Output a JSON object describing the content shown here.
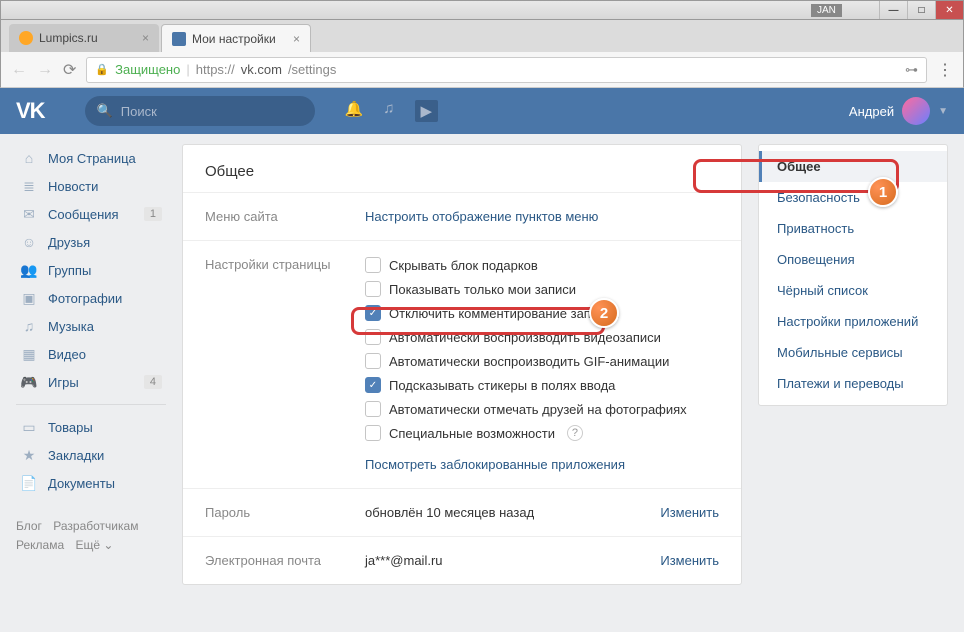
{
  "window": {
    "user_tag": "JAN"
  },
  "tabs": [
    {
      "label": "Lumpics.ru",
      "active": false
    },
    {
      "label": "Мои настройки",
      "active": true
    }
  ],
  "addr": {
    "secure_label": "Защищено",
    "scheme": "https://",
    "host": "vk.com",
    "path": "/settings"
  },
  "header": {
    "logo": "VK",
    "search_placeholder": "Поиск",
    "username": "Андрей"
  },
  "left_nav": {
    "items": [
      {
        "icon": "⌂",
        "label": "Моя Страница",
        "badge": ""
      },
      {
        "icon": "≣",
        "label": "Новости",
        "badge": ""
      },
      {
        "icon": "✉",
        "label": "Сообщения",
        "badge": "1"
      },
      {
        "icon": "☺",
        "label": "Друзья",
        "badge": ""
      },
      {
        "icon": "👥",
        "label": "Группы",
        "badge": ""
      },
      {
        "icon": "▣",
        "label": "Фотографии",
        "badge": ""
      },
      {
        "icon": "♫",
        "label": "Музыка",
        "badge": ""
      },
      {
        "icon": "▦",
        "label": "Видео",
        "badge": ""
      },
      {
        "icon": "🎮",
        "label": "Игры",
        "badge": "4"
      }
    ],
    "items2": [
      {
        "icon": "▭",
        "label": "Товары"
      },
      {
        "icon": "★",
        "label": "Закладки"
      },
      {
        "icon": "📄",
        "label": "Документы"
      }
    ],
    "footer": {
      "blog": "Блог",
      "dev": "Разработчикам",
      "ads": "Реклама",
      "more": "Ещё ⌄"
    }
  },
  "content": {
    "title": "Общее",
    "sections": {
      "menu": {
        "label": "Меню сайта",
        "link": "Настроить отображение пунктов меню"
      },
      "page": {
        "label": "Настройки страницы",
        "checkboxes": [
          {
            "checked": false,
            "label": "Скрывать блок подарков"
          },
          {
            "checked": false,
            "label": "Показывать только мои записи"
          },
          {
            "checked": true,
            "label": "Отключить комментирование записей"
          },
          {
            "checked": false,
            "label": "Автоматически воспроизводить видеозаписи"
          },
          {
            "checked": false,
            "label": "Автоматически воспроизводить GIF-анимации"
          },
          {
            "checked": true,
            "label": "Подсказывать стикеры в полях ввода"
          },
          {
            "checked": false,
            "label": "Автоматически отмечать друзей на фотографиях"
          },
          {
            "checked": false,
            "label": "Специальные возможности",
            "help": true
          }
        ],
        "blocked_link": "Посмотреть заблокированные приложения"
      },
      "password": {
        "label": "Пароль",
        "value": "обновлён 10 месяцев назад",
        "action": "Изменить"
      },
      "email": {
        "label": "Электронная почта",
        "value": "ja***@mail.ru",
        "action": "Изменить"
      }
    }
  },
  "right_nav": {
    "items": [
      "Общее",
      "Безопасность",
      "Приватность",
      "Оповещения",
      "Чёрный список",
      "Настройки приложений",
      "Мобильные сервисы",
      "Платежи и переводы"
    ],
    "active_index": 0
  },
  "callouts": {
    "1": "1",
    "2": "2"
  }
}
